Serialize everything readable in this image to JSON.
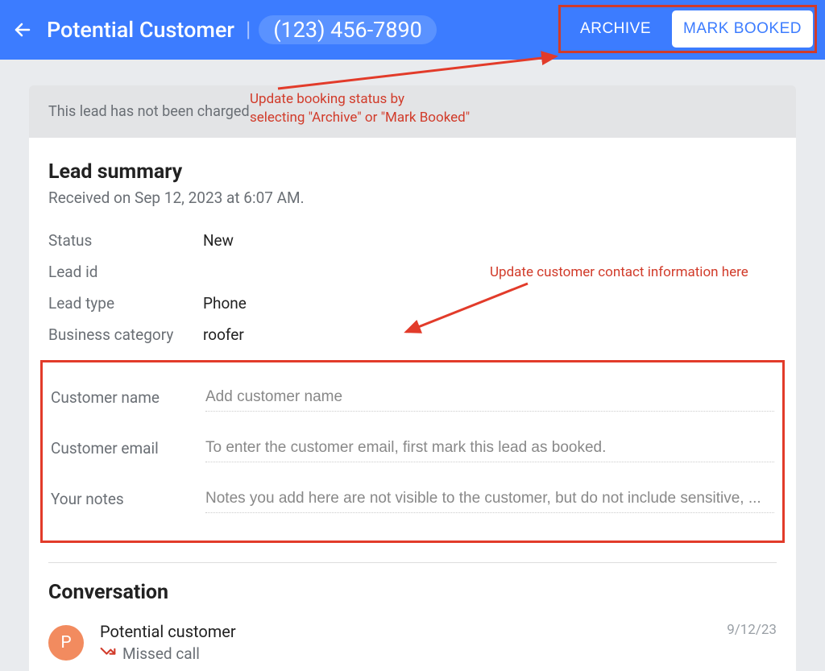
{
  "header": {
    "title": "Potential Customer",
    "phone": "(123) 456-7890",
    "archive_label": "ARCHIVE",
    "mark_booked_label": "MARK BOOKED"
  },
  "banner": "This lead has not been charged",
  "summary": {
    "title": "Lead summary",
    "received": "Received on Sep 12, 2023 at 6:07 AM.",
    "status_label": "Status",
    "status_value": "New",
    "leadid_label": "Lead id",
    "leadid_value": "",
    "leadtype_label": "Lead type",
    "leadtype_value": "Phone",
    "category_label": "Business category",
    "category_value": "roofer"
  },
  "form": {
    "name_label": "Customer name",
    "name_placeholder": "Add customer name",
    "email_label": "Customer email",
    "email_placeholder": "To enter the customer email, first mark this lead as booked.",
    "notes_label": "Your notes",
    "notes_placeholder": "Notes you add here are not visible to the customer, but do not include sensitive, ..."
  },
  "conversation": {
    "title": "Conversation",
    "avatar_letter": "P",
    "name": "Potential customer",
    "status": "Missed call",
    "date": "9/12/23"
  },
  "annotations": {
    "a1": "Update booking status by\nselecting \"Archive\" or \"Mark Booked\"",
    "a2": "Update customer contact information here"
  }
}
